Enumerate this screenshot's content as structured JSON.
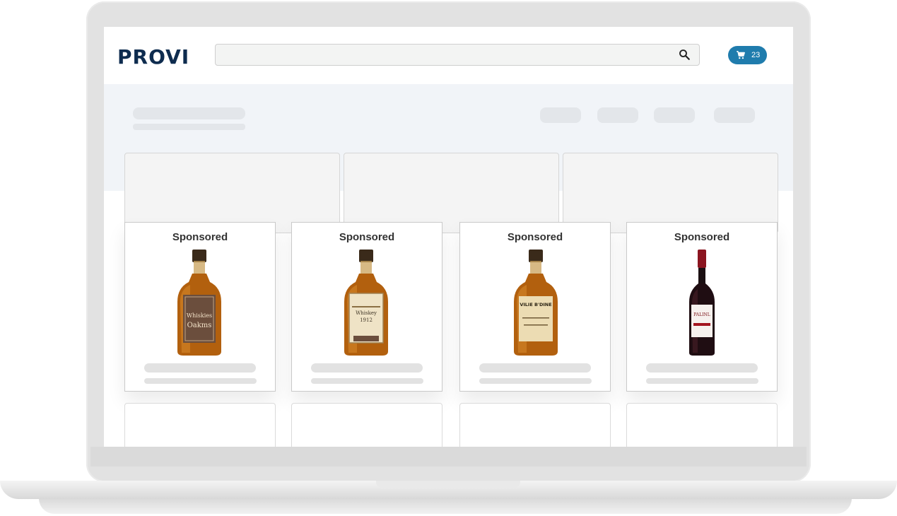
{
  "header": {
    "logo": "PROVI",
    "search": {
      "value": "",
      "placeholder": ""
    },
    "cart": {
      "count": "23",
      "icon": "cart-icon"
    },
    "search_icon": "search-icon"
  },
  "products": [
    {
      "badge": "Sponsored",
      "label_line1": "Whiskies",
      "label_line2": "Oakms"
    },
    {
      "badge": "Sponsored",
      "label_line1": "Whiskey",
      "label_line2": "1912"
    },
    {
      "badge": "Sponsored",
      "label_line1": "VILIE B'DINE",
      "label_line2": ""
    },
    {
      "badge": "Sponsored",
      "label_line1": "PALINL",
      "label_line2": ""
    }
  ],
  "colors": {
    "brand": "#0e2c4f",
    "accent": "#1f7cad"
  }
}
